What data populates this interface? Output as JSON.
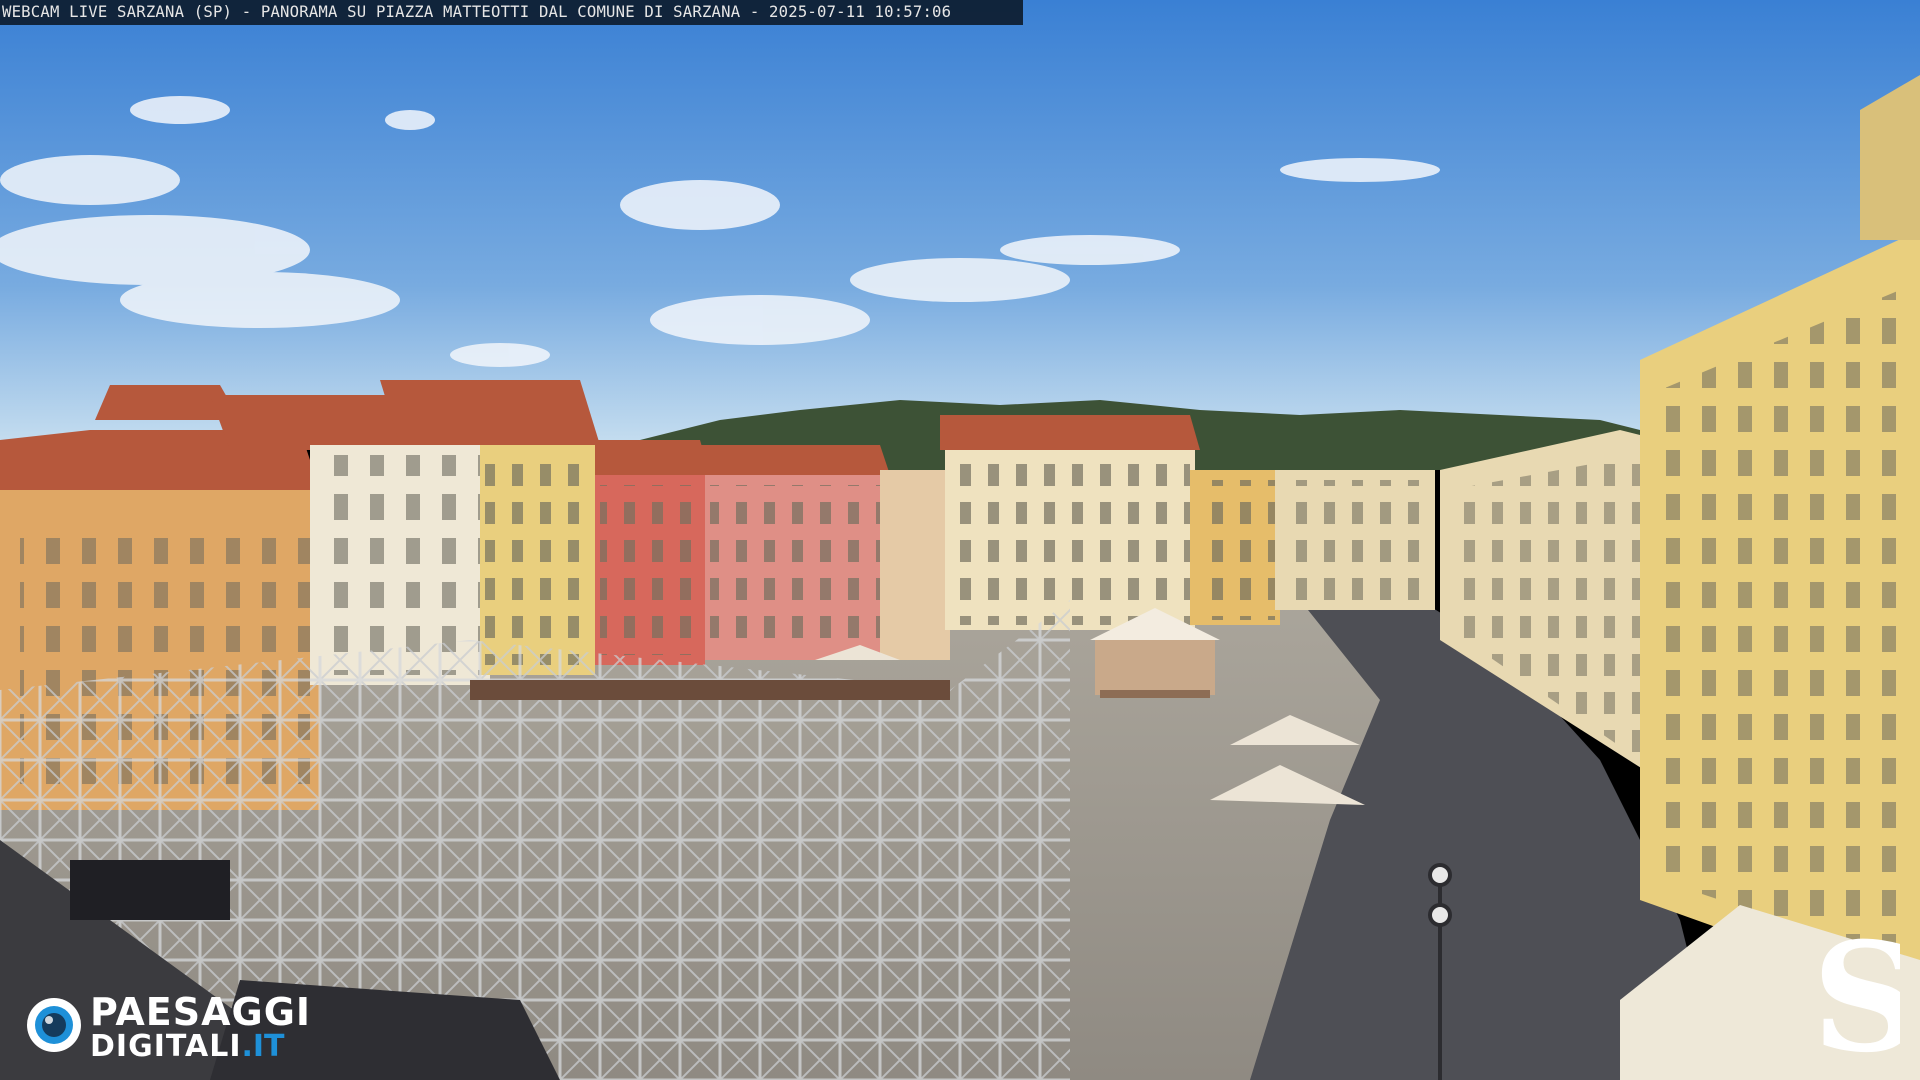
{
  "caption": "WEBCAM LIVE SARZANA (SP) - PANORAMA SU PIAZZA MATTEOTTI DAL COMUNE DI SARZANA - 2025-07-11   10:57:06",
  "logo_left": {
    "line1": "PAESAGGI",
    "line2_main": "DIGITALI",
    "line2_suffix": ".IT",
    "suffix_color": "#1e90d8"
  },
  "logo_right": {
    "glyph": "S"
  },
  "colors": {
    "sky_top": "#3f86d8",
    "sky_bottom": "#b9d6ee",
    "pavement": "#9a958c",
    "shadow": "#4e4f55",
    "building_orange": "#dfa765",
    "building_cream": "#efe2bf",
    "building_red": "#d7685c",
    "building_pink": "#df8f86",
    "building_yellow": "#e9cf7e",
    "roof": "#b6583c",
    "hills": "#3d5236"
  },
  "icons": [
    "camera-lens-icon",
    "sarzana-s-logo"
  ]
}
